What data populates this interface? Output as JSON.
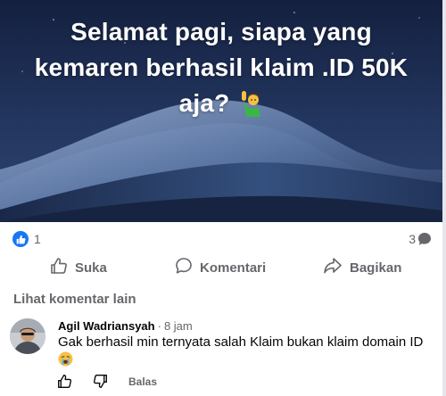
{
  "post": {
    "text": "Selamat pagi, siapa yang kemaren berhasil klaim .ID 50K aja?",
    "emoji_icon": "person-raising-hand-icon"
  },
  "stats": {
    "reactions": "1",
    "comments": "3"
  },
  "actions": {
    "like_label": "Suka",
    "comment_label": "Komentari",
    "share_label": "Bagikan"
  },
  "more_comments_label": "Lihat komentar lain",
  "comment": {
    "author": "Agil Wadriansyah",
    "separator": "·",
    "time": "8 jam",
    "text": "Gak berhasil min ternyata salah Klaim bukan klaim domain ID",
    "emoji_icon": "crying-face-icon",
    "reply_label": "Balas"
  },
  "colors": {
    "accent": "#1877f2",
    "muted": "#65676b",
    "hero_bg": "#1c2c52"
  }
}
